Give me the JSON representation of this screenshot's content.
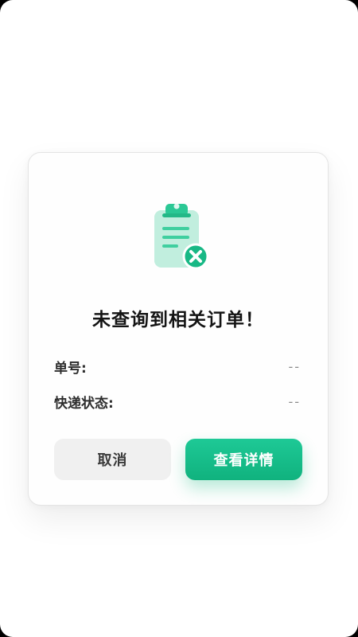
{
  "dialog": {
    "title": "未查询到相关订单！",
    "order_label": "单号:",
    "order_value": "--",
    "status_label": "快递状态:",
    "status_value": "--",
    "cancel_label": "取消",
    "detail_label": "查看详情"
  },
  "icons": {
    "main": "clipboard-x-icon"
  },
  "colors": {
    "accent": "#16b981",
    "accent_light": "#bfeedd",
    "cancel_bg": "#f0f0f0",
    "title_text": "#141414"
  }
}
